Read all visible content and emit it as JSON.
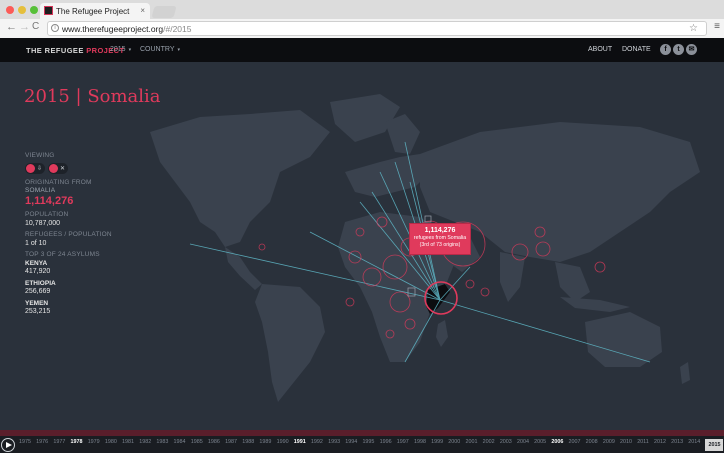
{
  "browser": {
    "tab_title": "The Refugee Project",
    "tab_close": "×",
    "url_prefix": "www.therefugeeproject.org",
    "url_suffix": "/#/2015",
    "back": "←",
    "forward": "→",
    "reload": "C",
    "star": "☆",
    "menu": "≡",
    "info": "i"
  },
  "header": {
    "brand_main": "THE REFUGEE",
    "brand_accent": "PROJECT",
    "year_select": "2015",
    "country_select": "COUNTRY",
    "about": "ABOUT",
    "donate": "DONATE",
    "social": [
      "f",
      "t",
      "✉"
    ],
    "caret": "▾"
  },
  "main": {
    "title": "2015 | Somalia"
  },
  "sidebar": {
    "viewing_label": "VIEWING",
    "view_icons": [
      "⇩",
      "✕"
    ],
    "originating_label": "ORIGINATING FROM",
    "originating_country": "SOMALIA",
    "originating_value": "1,114,276",
    "population_label": "POPULATION",
    "population_value": "10,787,000",
    "ratio_label": "REFUGEES / POPULATION",
    "ratio_value": "1 of 10",
    "top_label": "TOP 3 OF 24 ASYLUMS",
    "asylums": [
      {
        "name": "KENYA",
        "value": "417,920"
      },
      {
        "name": "ETHIOPIA",
        "value": "256,669"
      },
      {
        "name": "YEMEN",
        "value": "253,215"
      }
    ]
  },
  "callout": {
    "number": "1,114,276",
    "line1": "refugees from Somalia",
    "line2": "(3rd of 73 origins)"
  },
  "timeline": {
    "years": [
      "1975",
      "1976",
      "1977",
      "1978",
      "1979",
      "1980",
      "1981",
      "1982",
      "1983",
      "1984",
      "1985",
      "1986",
      "1987",
      "1988",
      "1989",
      "1990",
      "1991",
      "1992",
      "1993",
      "1994",
      "1995",
      "1996",
      "1997",
      "1998",
      "1999",
      "2000",
      "2001",
      "2002",
      "2003",
      "2004",
      "2005",
      "2006",
      "2007",
      "2008",
      "2009",
      "2010",
      "2011",
      "2012",
      "2013",
      "2014",
      "2015"
    ],
    "highlighted": [
      "1978",
      "1991",
      "2006"
    ],
    "current": "2015"
  },
  "colors": {
    "accent": "#e03a5c",
    "background": "#2a313b",
    "land": "#3a424e",
    "flow": "#5fb8c8"
  }
}
